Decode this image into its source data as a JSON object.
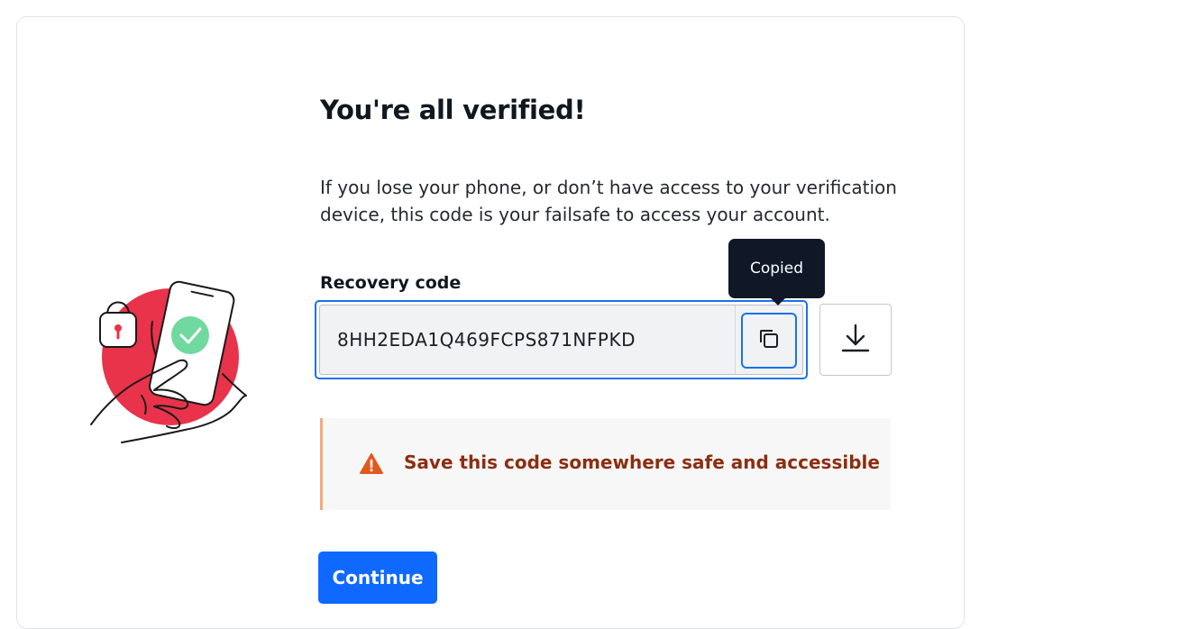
{
  "page": {
    "title": "You're all verified!",
    "description": "If you lose your phone, or don’t have access to your verification device, this code is your failsafe to access your account."
  },
  "recovery": {
    "label": "Recovery code",
    "code": "8HH2EDA1Q469FCPS871NFPKD",
    "copy_icon": "copy-icon",
    "download_icon": "download-icon",
    "tooltip": "Copied"
  },
  "warning": {
    "icon": "warning-icon",
    "text": "Save this code somewhere safe and accessible"
  },
  "actions": {
    "continue_label": "Continue"
  },
  "colors": {
    "primary": "#0f69ff",
    "focus": "#1a73e8",
    "warning_text": "#8c2e12",
    "warning_icon": "#e2591e",
    "warning_border": "#f3a97a",
    "illustration_red": "#e8334a",
    "illustration_green": "#6fd9a0",
    "tooltip_bg": "#101828"
  }
}
